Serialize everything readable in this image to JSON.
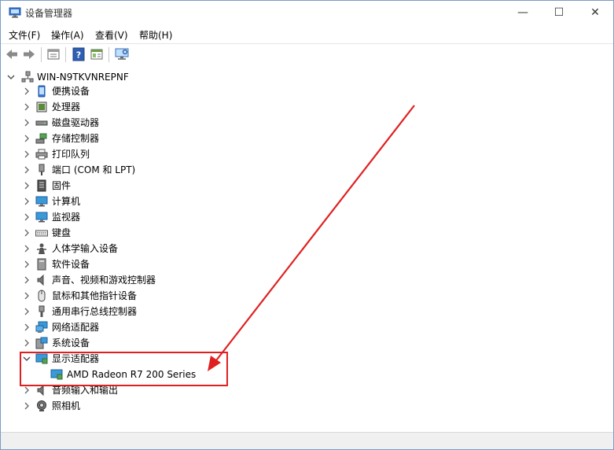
{
  "window": {
    "title": "设备管理器",
    "controls": {
      "minimize": "—",
      "maximize": "☐",
      "close": "✕"
    }
  },
  "menu": [
    {
      "label": "文件(F)"
    },
    {
      "label": "操作(A)"
    },
    {
      "label": "查看(V)"
    },
    {
      "label": "帮助(H)"
    }
  ],
  "toolbar": {
    "icons": [
      "back-arrow-icon",
      "forward-arrow-icon",
      "properties-icon",
      "help-icon",
      "view-icon",
      "monitor-scan-icon"
    ]
  },
  "tree": {
    "root": "WIN-N9TKVNREPNF",
    "categories": [
      {
        "label": "便携设备",
        "icon": "portable-device-icon"
      },
      {
        "label": "处理器",
        "icon": "processor-icon"
      },
      {
        "label": "磁盘驱动器",
        "icon": "disk-drive-icon"
      },
      {
        "label": "存储控制器",
        "icon": "storage-controller-icon"
      },
      {
        "label": "打印队列",
        "icon": "printer-icon"
      },
      {
        "label": "端口 (COM 和 LPT)",
        "icon": "port-icon"
      },
      {
        "label": "固件",
        "icon": "firmware-icon"
      },
      {
        "label": "计算机",
        "icon": "computer-icon"
      },
      {
        "label": "监视器",
        "icon": "monitor-icon"
      },
      {
        "label": "键盘",
        "icon": "keyboard-icon"
      },
      {
        "label": "人体学输入设备",
        "icon": "hid-icon"
      },
      {
        "label": "软件设备",
        "icon": "software-device-icon"
      },
      {
        "label": "声音、视频和游戏控制器",
        "icon": "speaker-icon"
      },
      {
        "label": "鼠标和其他指针设备",
        "icon": "mouse-icon"
      },
      {
        "label": "通用串行总线控制器",
        "icon": "usb-icon"
      },
      {
        "label": "网络适配器",
        "icon": "network-adapter-icon"
      },
      {
        "label": "系统设备",
        "icon": "system-device-icon"
      },
      {
        "label": "显示适配器",
        "icon": "display-adapter-icon",
        "expanded": true,
        "children": [
          {
            "label": "AMD Radeon R7 200 Series",
            "icon": "display-adapter-icon"
          }
        ]
      },
      {
        "label": "音频输入和输出",
        "icon": "audio-io-icon"
      },
      {
        "label": "照相机",
        "icon": "camera-icon"
      }
    ]
  },
  "colors": {
    "annotation": "#e02020",
    "chevron": "#666666"
  }
}
